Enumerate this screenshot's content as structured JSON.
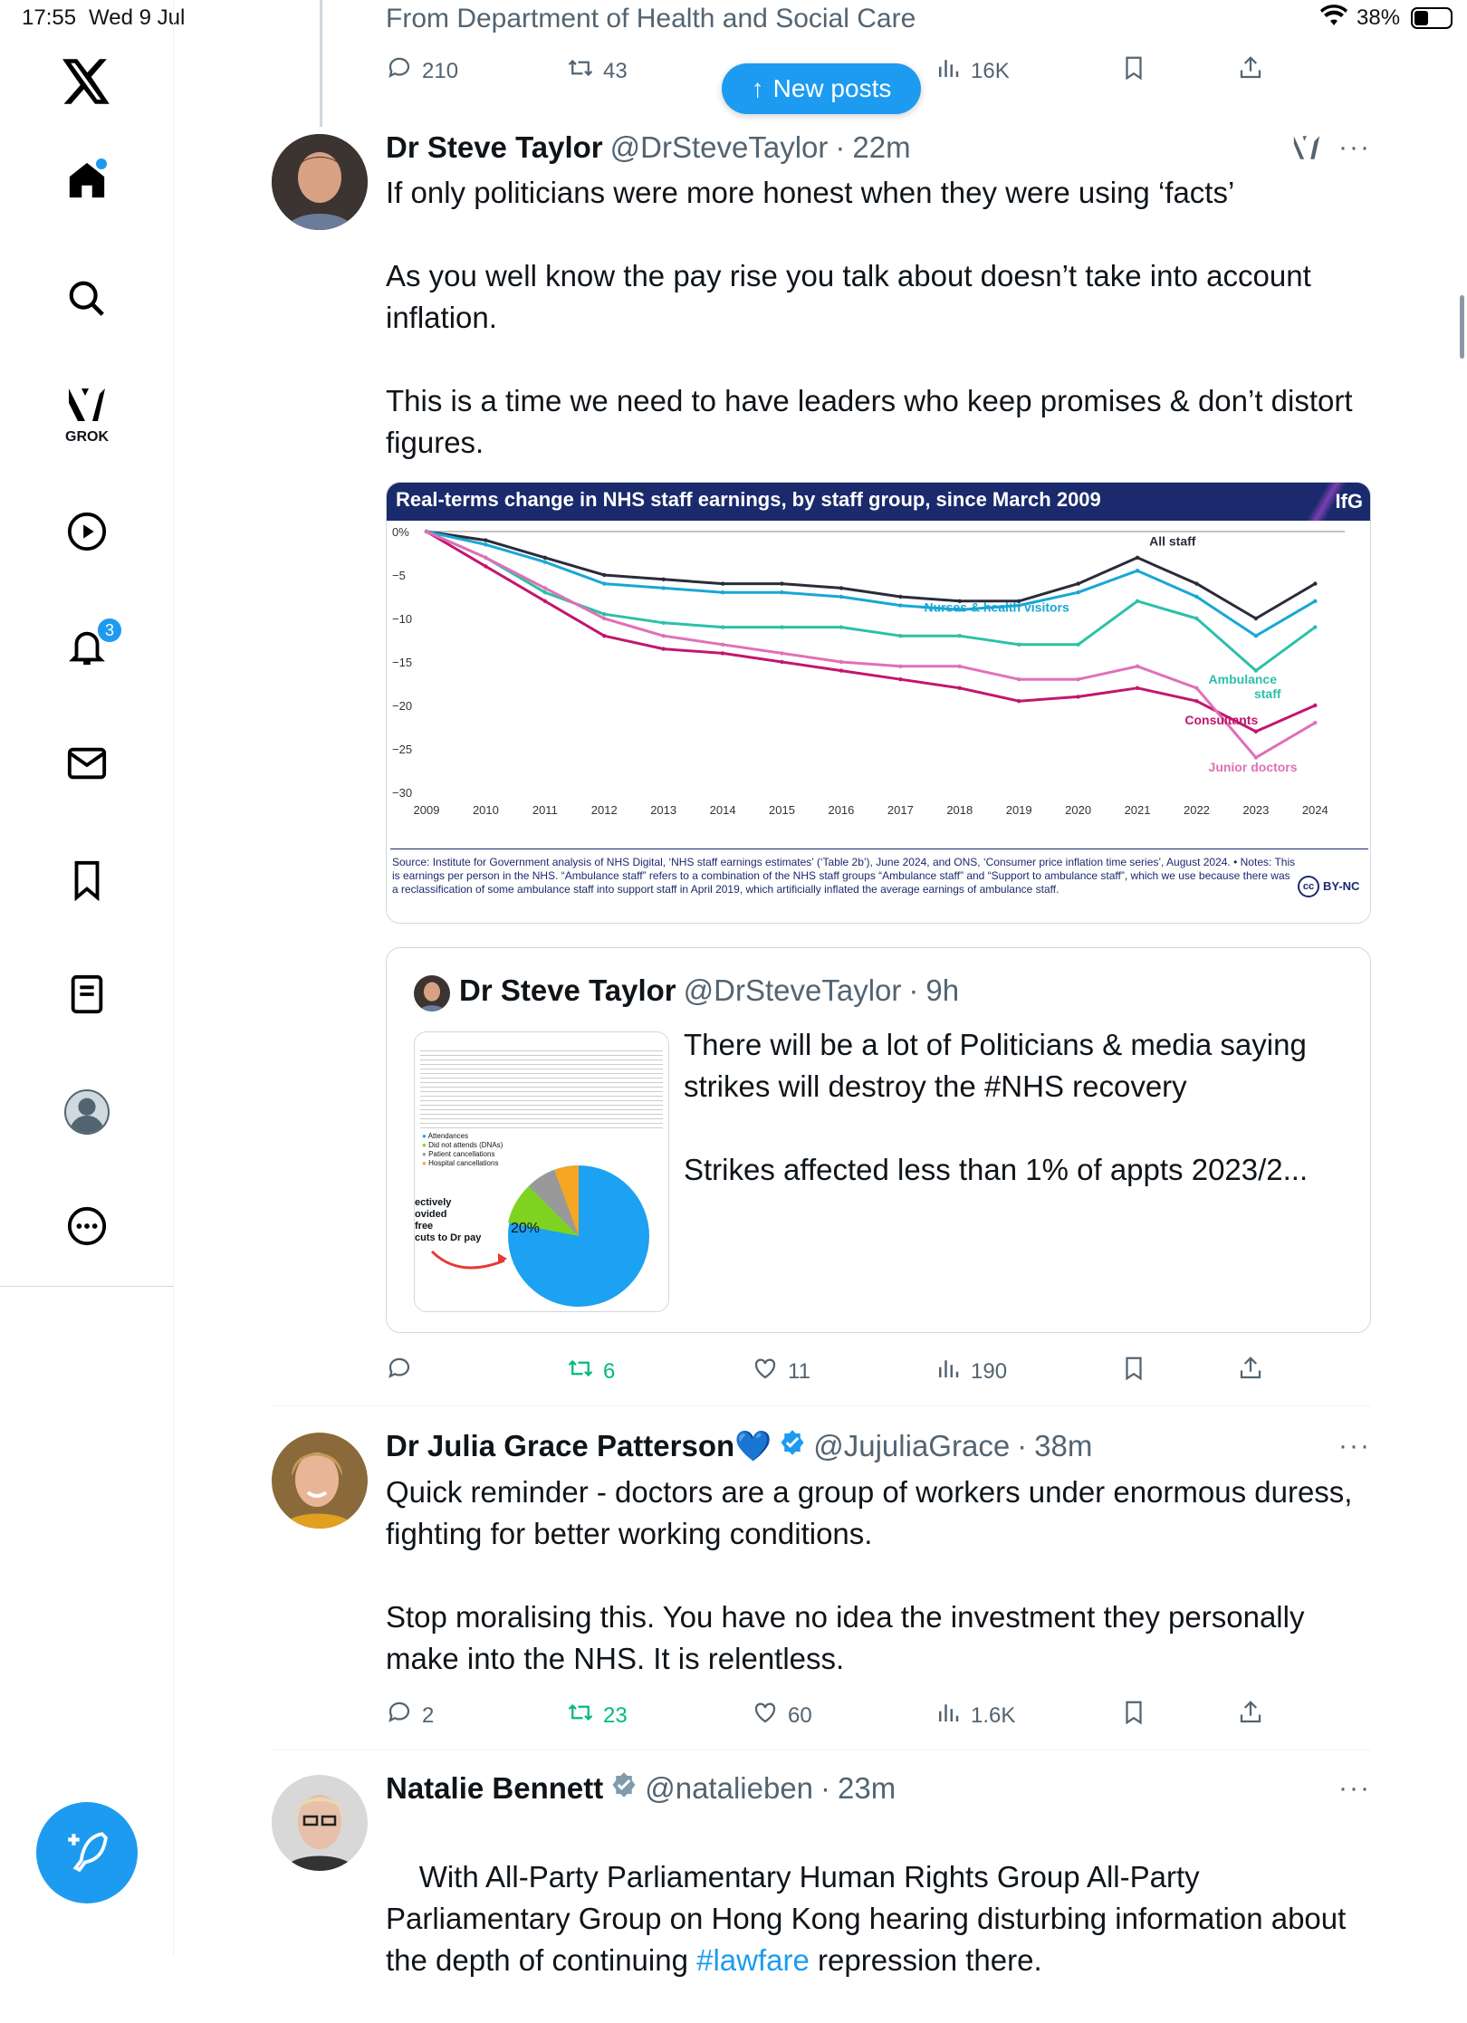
{
  "status": {
    "time": "17:55",
    "date": "Wed 9 Jul",
    "battery": "38%"
  },
  "sidebar": {
    "grok_label": "GROK",
    "notif_count": "3"
  },
  "new_posts": "New posts",
  "tweet0": {
    "source": "From Department of Health and Social Care",
    "replies": "210",
    "retweets": "43",
    "views": "16K"
  },
  "tweet1": {
    "name": "Dr Steve Taylor",
    "handle": "@DrSteveTaylor",
    "time": "22m",
    "dot": "·",
    "text": "If only politicians were more honest when they were using ‘facts’\n\nAs you well know the pay rise you talk about doesn’t take into account inflation.\n\nThis is a time we need to have leaders who keep promises & don’t distort figures.",
    "retweets": "6",
    "likes": "11",
    "views": "190",
    "quote": {
      "name": "Dr Steve Taylor",
      "handle": "@DrSteveTaylor",
      "time": "9h",
      "text": "There will be a lot of Politicians & media saying strikes will destroy the #NHS recovery\n\nStrikes affected less than 1% of appts 2023/2...",
      "thumb": {
        "legend": [
          "Attendances",
          "Did not attends (DNAs)",
          "Patient cancellations",
          "Hospital cancellations"
        ],
        "left_text": [
          "ectively",
          "ovided",
          "free",
          "cuts to Dr pay"
        ],
        "pct": "20%"
      }
    }
  },
  "chart": {
    "title": "Real-terms change in NHS staff earnings, by staff group, since March 2009",
    "brand": "IfG",
    "footer": "Source: Institute for Government analysis of NHS Digital, ‘NHS staff earnings estimates’ (‘Table 2b’), June 2024, and ONS, ‘Consumer price inflation time series’, August 2024. • Notes: This is earnings per person in the NHS. “Ambulance staff” refers to a combination of the NHS staff groups “Ambulance staff” and “Support to ambulance staff”, which we use because there was a reclassification of some ambulance staff into support staff in April 2019, which artificially inflated the average earnings of ambulance staff.",
    "license": "BY-NC",
    "cc": "cc"
  },
  "chart_data": {
    "type": "line",
    "title": "Real-terms change in NHS staff earnings, by staff group, since March 2009",
    "x": [
      2009,
      2010,
      2011,
      2012,
      2013,
      2014,
      2015,
      2016,
      2017,
      2018,
      2019,
      2020,
      2021,
      2022,
      2023,
      2024
    ],
    "y_ticks": [
      "0%",
      "−5",
      "−10",
      "−15",
      "−20",
      "−25",
      "−30"
    ],
    "ylim": [
      -30,
      0
    ],
    "x_ticks": [
      "2009",
      "2010",
      "2011",
      "2012",
      "2013",
      "2014",
      "2015",
      "2016",
      "2017",
      "2018",
      "2019",
      "2020",
      "2021",
      "2022",
      "2023",
      "2024"
    ],
    "series": [
      {
        "name": "All staff",
        "color": "#2b2b3a",
        "values": [
          0,
          -1,
          -3,
          -5,
          -5.5,
          -6,
          -6,
          -6.5,
          -7.5,
          -8,
          -8,
          -6,
          -3,
          -6,
          -10,
          -6
        ]
      },
      {
        "name": "Nurses & health visitors",
        "color": "#18a7d6",
        "values": [
          0,
          -1.5,
          -3.5,
          -6,
          -6.5,
          -7,
          -7,
          -7.5,
          -8.5,
          -9,
          -8.5,
          -7,
          -4.5,
          -7.5,
          -12,
          -8
        ]
      },
      {
        "name": "Ambulance staff",
        "color": "#2cc0a8",
        "values": [
          0,
          -3,
          -7,
          -9.5,
          -10.5,
          -11,
          -11,
          -11,
          -12,
          -12,
          -13,
          -13,
          -8,
          -10,
          -16,
          -11
        ]
      },
      {
        "name": "Consultants",
        "color": "#c3166e",
        "values": [
          0,
          -4,
          -8,
          -12,
          -13.5,
          -14,
          -15,
          -16,
          -17,
          -18,
          -19.5,
          -19,
          -18,
          -19.5,
          -23,
          -20
        ]
      },
      {
        "name": "Junior doctors",
        "color": "#e070b8",
        "values": [
          0,
          -3,
          -6.5,
          -10,
          -12,
          -13,
          -14,
          -15,
          -15.5,
          -15.5,
          -17,
          -17,
          -15.5,
          -18,
          -26,
          -22
        ]
      }
    ]
  },
  "tweet2": {
    "name": "Dr Julia Grace Patterson💙",
    "handle": "@JujuliaGrace",
    "time": "38m",
    "dot": "·",
    "text": "Quick reminder - doctors are a group of workers under enormous duress, fighting for better working conditions.\n\nStop moralising this. You have no idea the investment they personally make into the NHS. It is relentless.",
    "replies": "2",
    "retweets": "23",
    "likes": "60",
    "views": "1.6K"
  },
  "tweet3": {
    "name": "Natalie Bennett",
    "handle": "@natalieben",
    "time": "23m",
    "dot": "·",
    "text_before": "With All-Party Parliamentary Human Rights Group All-Party Parliamentary Group on Hong Kong hearing disturbing information about the depth of continuing ",
    "hashtag": "#lawfare",
    "text_after": " repression there."
  },
  "more": "···"
}
